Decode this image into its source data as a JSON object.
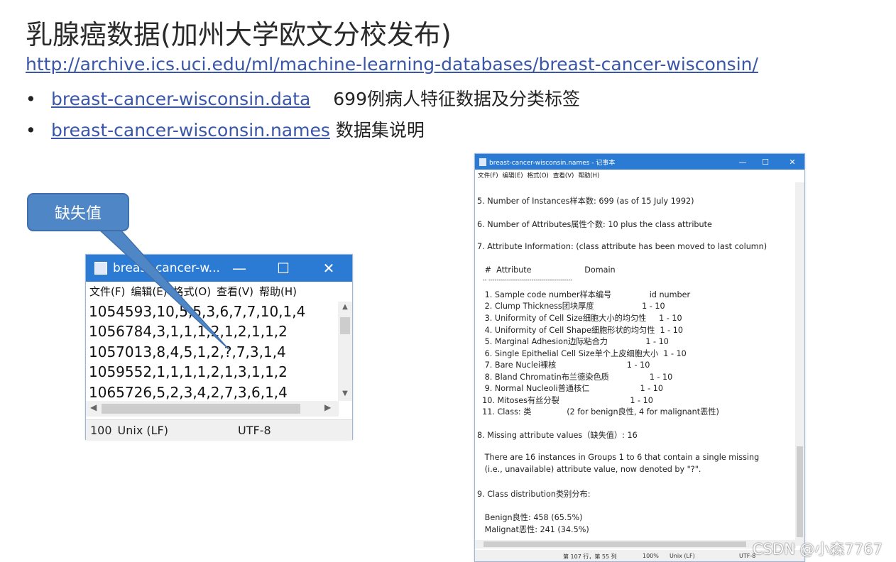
{
  "slide": {
    "title": "乳腺癌数据(加州大学欧文分校发布)",
    "url": "http://archive.ics.uci.edu/ml/machine-learning-databases/breast-cancer-wisconsin/",
    "bullets": [
      {
        "dot": "•",
        "link": "breast-cancer-wisconsin.data",
        "desc": "699例病人特征数据及分类标签"
      },
      {
        "dot": "•",
        "link": "breast-cancer-wisconsin.names",
        "desc": "数据集说明"
      }
    ],
    "callout": "缺失值"
  },
  "small_notepad": {
    "title": "breast-cancer-w...",
    "controls": {
      "minimize": "—",
      "maximize": "☐",
      "close": "✕"
    },
    "menu": [
      "文件(F)",
      "编辑(E)",
      "格式(O)",
      "查看(V)",
      "帮助(H)"
    ],
    "lines": [
      "1054593,10,5,5,3,6,7,7,10,1,4",
      "1056784,3,1,1,1,2,1,2,1,1,2",
      "1057013,8,4,5,1,2,?,7,3,1,4",
      "1059552,1,1,1,1,2,1,3,1,1,2",
      "1065726,5,2,3,4,2,7,3,6,1,4"
    ],
    "status": {
      "zoom": "100",
      "eol": "Unix (LF)",
      "encoding": "UTF-8"
    }
  },
  "big_notepad": {
    "title": "breast-cancer-wisconsin.names - 记事本",
    "controls": {
      "minimize": "—",
      "maximize": "☐",
      "close": "✕"
    },
    "menu": [
      "文件(F)",
      "编辑(E)",
      "格式(O)",
      "查看(V)",
      "帮助(H)"
    ],
    "lines": [
      "5. Number of Instances样本数: 699 (as of 15 July 1992)",
      "6. Number of Attributes属性个数: 10 plus the class attribute",
      "7. Attribute Information: (class attribute has been moved to last column)",
      "   #  Attribute                     Domain",
      "   -- -----------------------------------------",
      "   1. Sample code number样本编号               id number",
      "   2. Clump Thickness团块厚度                   1 - 10",
      "   3. Uniformity of Cell Size细胞大小的均匀性     1 - 10",
      "   4. Uniformity of Cell Shape细胞形状的均匀性  1 - 10",
      "   5. Marginal Adhesion边际粘合力               1 - 10",
      "   6. Single Epithelial Cell Size单个上皮细胞大小  1 - 10",
      "   7. Bare Nuclei裸核                            1 - 10",
      "   8. Bland Chromatin布兰德染色质                1 - 10",
      "   9. Normal Nucleoli普通核仁                    1 - 10",
      "  10. Mitoses有丝分裂                            1 - 10",
      "  11. Class: 类              (2 for benign良性, 4 for malignant恶性)",
      "8. Missing attribute values（缺失值）: 16",
      "   There are 16 instances in Groups 1 to 6 that contain a single missing",
      "   (i.e., unavailable) attribute value, now denoted by \"?\".",
      "9. Class distribution类别分布:",
      "   Benign良性: 458 (65.5%)",
      "   Malignat恶性: 241 (34.5%)"
    ],
    "status": {
      "position": "第 107 行，第 55 列",
      "zoom": "100%",
      "eol": "Unix (LF)",
      "encoding": "UTF-8"
    }
  },
  "watermark": "CSDN @小森7767"
}
